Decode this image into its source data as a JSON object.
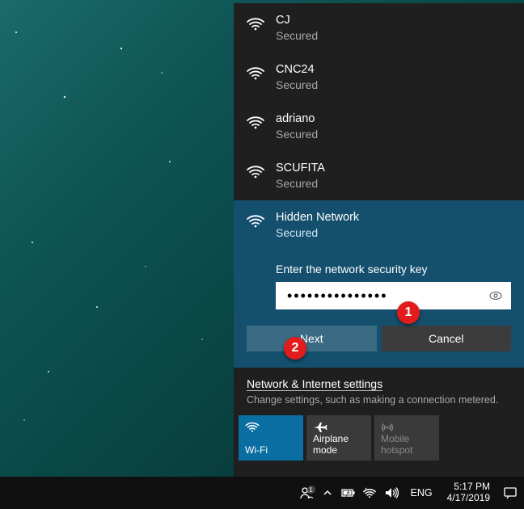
{
  "networks": [
    {
      "name": "CJ",
      "status": "Secured"
    },
    {
      "name": "CNC24",
      "status": "Secured"
    },
    {
      "name": "adriano",
      "status": "Secured"
    },
    {
      "name": "SCUFITA",
      "status": "Secured"
    }
  ],
  "selected_network": {
    "name": "Hidden Network",
    "status": "Secured",
    "prompt": "Enter the network security key",
    "password_mask": "•••••••••••••••",
    "next_label": "Next",
    "cancel_label": "Cancel"
  },
  "settings": {
    "link": "Network & Internet settings",
    "sub": "Change settings, such as making a connection metered."
  },
  "tiles": {
    "wifi": "Wi-Fi",
    "airplane": "Airplane mode",
    "hotspot_l1": "Mobile",
    "hotspot_l2": "hotspot"
  },
  "taskbar": {
    "language": "ENG",
    "time": "5:17 PM",
    "date": "4/17/2019"
  },
  "callouts": {
    "one": "1",
    "two": "2"
  }
}
